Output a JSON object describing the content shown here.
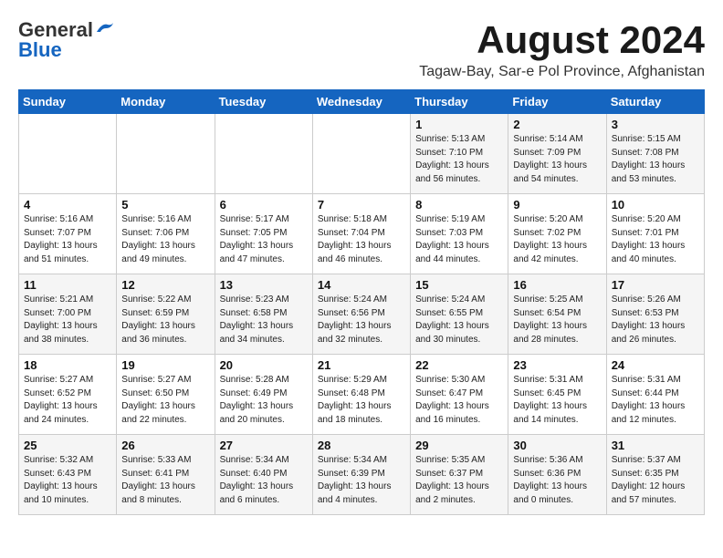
{
  "header": {
    "logo_general": "General",
    "logo_blue": "Blue",
    "month_year": "August 2024",
    "location": "Tagaw-Bay, Sar-e Pol Province, Afghanistan"
  },
  "days_of_week": [
    "Sunday",
    "Monday",
    "Tuesday",
    "Wednesday",
    "Thursday",
    "Friday",
    "Saturday"
  ],
  "weeks": [
    [
      {
        "day": "",
        "info": ""
      },
      {
        "day": "",
        "info": ""
      },
      {
        "day": "",
        "info": ""
      },
      {
        "day": "",
        "info": ""
      },
      {
        "day": "1",
        "info": "Sunrise: 5:13 AM\nSunset: 7:10 PM\nDaylight: 13 hours\nand 56 minutes."
      },
      {
        "day": "2",
        "info": "Sunrise: 5:14 AM\nSunset: 7:09 PM\nDaylight: 13 hours\nand 54 minutes."
      },
      {
        "day": "3",
        "info": "Sunrise: 5:15 AM\nSunset: 7:08 PM\nDaylight: 13 hours\nand 53 minutes."
      }
    ],
    [
      {
        "day": "4",
        "info": "Sunrise: 5:16 AM\nSunset: 7:07 PM\nDaylight: 13 hours\nand 51 minutes."
      },
      {
        "day": "5",
        "info": "Sunrise: 5:16 AM\nSunset: 7:06 PM\nDaylight: 13 hours\nand 49 minutes."
      },
      {
        "day": "6",
        "info": "Sunrise: 5:17 AM\nSunset: 7:05 PM\nDaylight: 13 hours\nand 47 minutes."
      },
      {
        "day": "7",
        "info": "Sunrise: 5:18 AM\nSunset: 7:04 PM\nDaylight: 13 hours\nand 46 minutes."
      },
      {
        "day": "8",
        "info": "Sunrise: 5:19 AM\nSunset: 7:03 PM\nDaylight: 13 hours\nand 44 minutes."
      },
      {
        "day": "9",
        "info": "Sunrise: 5:20 AM\nSunset: 7:02 PM\nDaylight: 13 hours\nand 42 minutes."
      },
      {
        "day": "10",
        "info": "Sunrise: 5:20 AM\nSunset: 7:01 PM\nDaylight: 13 hours\nand 40 minutes."
      }
    ],
    [
      {
        "day": "11",
        "info": "Sunrise: 5:21 AM\nSunset: 7:00 PM\nDaylight: 13 hours\nand 38 minutes."
      },
      {
        "day": "12",
        "info": "Sunrise: 5:22 AM\nSunset: 6:59 PM\nDaylight: 13 hours\nand 36 minutes."
      },
      {
        "day": "13",
        "info": "Sunrise: 5:23 AM\nSunset: 6:58 PM\nDaylight: 13 hours\nand 34 minutes."
      },
      {
        "day": "14",
        "info": "Sunrise: 5:24 AM\nSunset: 6:56 PM\nDaylight: 13 hours\nand 32 minutes."
      },
      {
        "day": "15",
        "info": "Sunrise: 5:24 AM\nSunset: 6:55 PM\nDaylight: 13 hours\nand 30 minutes."
      },
      {
        "day": "16",
        "info": "Sunrise: 5:25 AM\nSunset: 6:54 PM\nDaylight: 13 hours\nand 28 minutes."
      },
      {
        "day": "17",
        "info": "Sunrise: 5:26 AM\nSunset: 6:53 PM\nDaylight: 13 hours\nand 26 minutes."
      }
    ],
    [
      {
        "day": "18",
        "info": "Sunrise: 5:27 AM\nSunset: 6:52 PM\nDaylight: 13 hours\nand 24 minutes."
      },
      {
        "day": "19",
        "info": "Sunrise: 5:27 AM\nSunset: 6:50 PM\nDaylight: 13 hours\nand 22 minutes."
      },
      {
        "day": "20",
        "info": "Sunrise: 5:28 AM\nSunset: 6:49 PM\nDaylight: 13 hours\nand 20 minutes."
      },
      {
        "day": "21",
        "info": "Sunrise: 5:29 AM\nSunset: 6:48 PM\nDaylight: 13 hours\nand 18 minutes."
      },
      {
        "day": "22",
        "info": "Sunrise: 5:30 AM\nSunset: 6:47 PM\nDaylight: 13 hours\nand 16 minutes."
      },
      {
        "day": "23",
        "info": "Sunrise: 5:31 AM\nSunset: 6:45 PM\nDaylight: 13 hours\nand 14 minutes."
      },
      {
        "day": "24",
        "info": "Sunrise: 5:31 AM\nSunset: 6:44 PM\nDaylight: 13 hours\nand 12 minutes."
      }
    ],
    [
      {
        "day": "25",
        "info": "Sunrise: 5:32 AM\nSunset: 6:43 PM\nDaylight: 13 hours\nand 10 minutes."
      },
      {
        "day": "26",
        "info": "Sunrise: 5:33 AM\nSunset: 6:41 PM\nDaylight: 13 hours\nand 8 minutes."
      },
      {
        "day": "27",
        "info": "Sunrise: 5:34 AM\nSunset: 6:40 PM\nDaylight: 13 hours\nand 6 minutes."
      },
      {
        "day": "28",
        "info": "Sunrise: 5:34 AM\nSunset: 6:39 PM\nDaylight: 13 hours\nand 4 minutes."
      },
      {
        "day": "29",
        "info": "Sunrise: 5:35 AM\nSunset: 6:37 PM\nDaylight: 13 hours\nand 2 minutes."
      },
      {
        "day": "30",
        "info": "Sunrise: 5:36 AM\nSunset: 6:36 PM\nDaylight: 13 hours\nand 0 minutes."
      },
      {
        "day": "31",
        "info": "Sunrise: 5:37 AM\nSunset: 6:35 PM\nDaylight: 12 hours\nand 57 minutes."
      }
    ]
  ]
}
